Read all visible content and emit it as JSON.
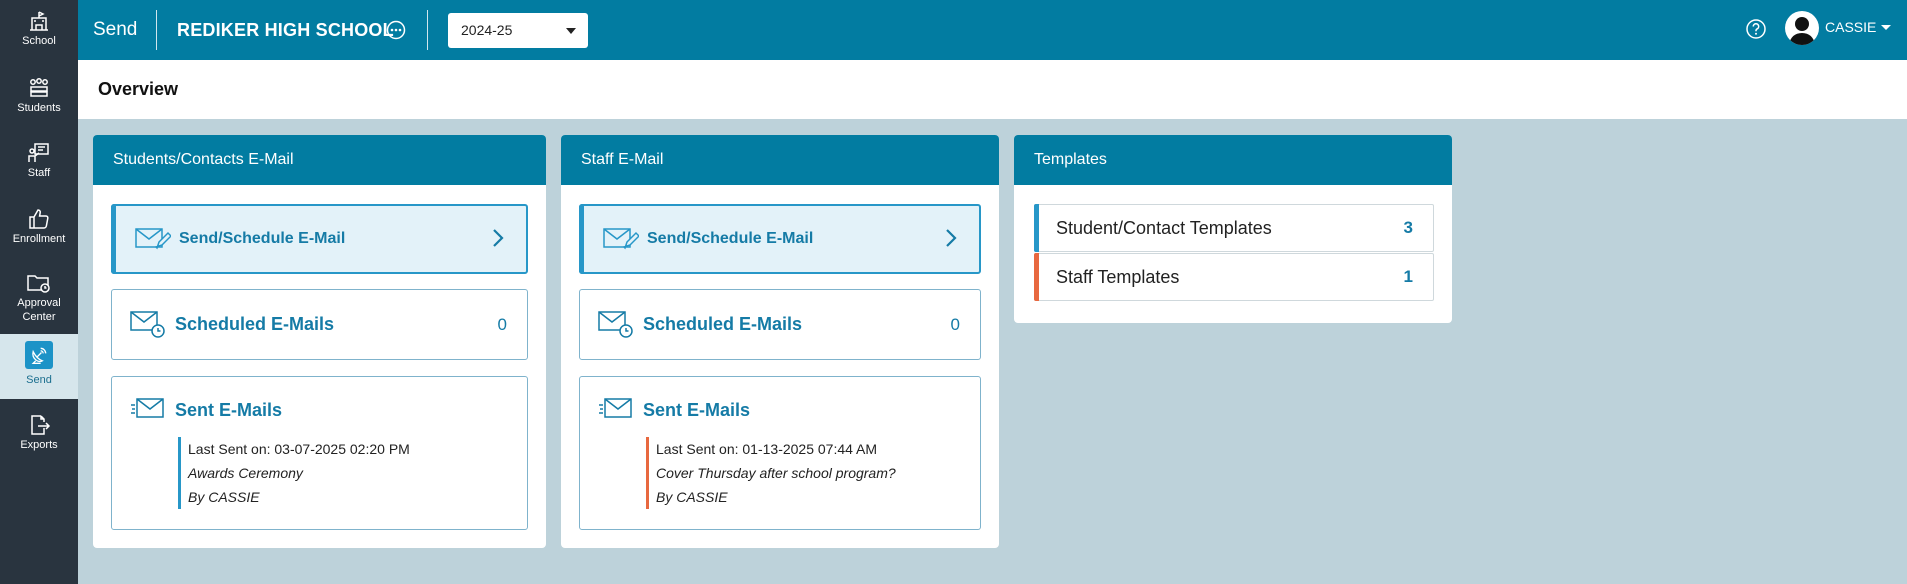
{
  "sidebar": {
    "items": [
      {
        "label": "School",
        "icon": "school-icon"
      },
      {
        "label": "Students",
        "icon": "students-icon"
      },
      {
        "label": "Staff",
        "icon": "staff-icon"
      },
      {
        "label": "Enrollment",
        "icon": "thumbs-up-icon"
      },
      {
        "label_line1": "Approval",
        "label_line2": "Center",
        "icon": "folder-clock-icon"
      },
      {
        "label": "Send",
        "icon": "satellite-dish-icon",
        "active": true
      },
      {
        "label": "Exports",
        "icon": "export-icon"
      }
    ]
  },
  "topbar": {
    "module": "Send",
    "school": "REDIKER HIGH SCHOOL",
    "year": "2024-25",
    "user": "CASSIE"
  },
  "page": {
    "title": "Overview"
  },
  "students_card": {
    "title": "Students/Contacts E-Mail",
    "send_label": "Send/Schedule E-Mail",
    "scheduled_label": "Scheduled E-Mails",
    "scheduled_count": "0",
    "sent_label": "Sent E-Mails",
    "last_sent": "Last Sent on: 03-07-2025 02:20 PM",
    "subject": "Awards Ceremony",
    "by": "By CASSIE"
  },
  "staff_card": {
    "title": "Staff E-Mail",
    "send_label": "Send/Schedule E-Mail",
    "scheduled_label": "Scheduled E-Mails",
    "scheduled_count": "0",
    "sent_label": "Sent E-Mails",
    "last_sent": "Last Sent on: 01-13-2025 07:44 AM",
    "subject": "Cover Thursday after school program?",
    "by": "By CASSIE"
  },
  "templates_card": {
    "title": "Templates",
    "rows": [
      {
        "label": "Student/Contact Templates",
        "count": "3"
      },
      {
        "label": "Staff Templates",
        "count": "1"
      }
    ]
  },
  "colors": {
    "topbar": "#027ca1",
    "sidebar": "#29343f",
    "background": "#bdd2da",
    "accent_blue": "#2797c8",
    "accent_orange": "#e8683f",
    "link": "#157ba6"
  }
}
